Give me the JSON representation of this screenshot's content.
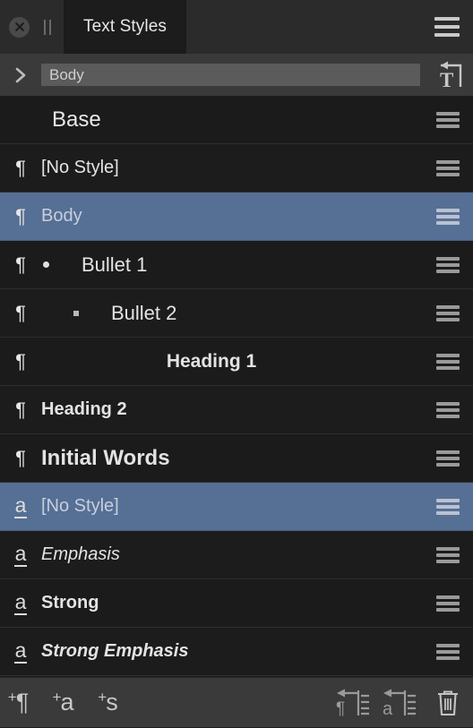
{
  "window": {
    "title": "Text Styles",
    "close_icon": "close-circle-icon",
    "grip_icon": "drag-grip-icon",
    "panel_menu_icon": "hamburger-menu-icon"
  },
  "breadcrumb": {
    "expand_icon": "chevron-right-icon",
    "field_value": "Body",
    "apply_icon": "apply-text-style-icon"
  },
  "list": {
    "rows": [
      {
        "kind": "group",
        "icon": "none",
        "label": "Base",
        "selected": false
      },
      {
        "kind": "paragraph",
        "icon": "pilcrow-icon",
        "label": "[No Style]",
        "selected": false
      },
      {
        "kind": "paragraph",
        "icon": "pilcrow-icon",
        "label": "Body",
        "selected": true
      },
      {
        "kind": "paragraph",
        "icon": "pilcrow-icon",
        "label": "Bullet 1",
        "selected": false
      },
      {
        "kind": "paragraph",
        "icon": "pilcrow-icon",
        "label": "Bullet 2",
        "selected": false
      },
      {
        "kind": "paragraph",
        "icon": "pilcrow-icon",
        "label": "Heading 1",
        "selected": false
      },
      {
        "kind": "paragraph",
        "icon": "pilcrow-icon",
        "label": "Heading 2",
        "selected": false
      },
      {
        "kind": "paragraph",
        "icon": "pilcrow-icon",
        "label": "Initial Words",
        "selected": false
      },
      {
        "kind": "character",
        "icon": "character-style-icon",
        "label": "[No Style]",
        "selected": true
      },
      {
        "kind": "character",
        "icon": "character-style-icon",
        "label": "Emphasis",
        "selected": false
      },
      {
        "kind": "character",
        "icon": "character-style-icon",
        "label": "Strong",
        "selected": false
      },
      {
        "kind": "character",
        "icon": "character-style-icon",
        "label": "Strong Emphasis",
        "selected": false
      }
    ],
    "row_menu_icon": "hamburger-menu-icon"
  },
  "toolbar": {
    "new_paragraph_style": {
      "icon": "new-paragraph-style-icon",
      "plus": "+",
      "glyph": "¶"
    },
    "new_character_style": {
      "icon": "new-character-style-icon",
      "plus": "+",
      "glyph": "a"
    },
    "new_section_style": {
      "icon": "new-section-style-icon",
      "plus": "+",
      "glyph": "s"
    },
    "redefine_paragraph": {
      "icon": "redefine-paragraph-style-icon"
    },
    "redefine_character": {
      "icon": "redefine-character-style-icon"
    },
    "delete": {
      "icon": "trash-icon"
    }
  },
  "colors": {
    "selection": "#566f94",
    "titlebar": "#2b2b2b",
    "panel": "#1c1c1c",
    "toolbar": "#3a3a3a",
    "text": "#e3e3e3"
  }
}
